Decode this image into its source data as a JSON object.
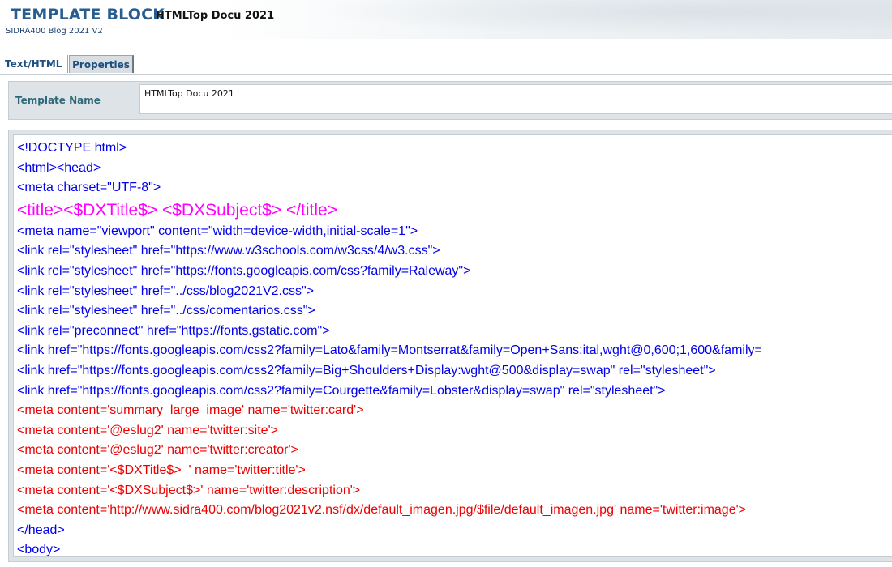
{
  "header": {
    "title": "TEMPLATE BLOCK",
    "subtitle": "HTMLTop Docu 2021",
    "app_name": "SIDRA400 Blog 2021 V2"
  },
  "tabs": [
    {
      "label": "Text/HTML",
      "active": true
    },
    {
      "label": "Properties",
      "active": false
    }
  ],
  "template_name": {
    "label": "Template Name",
    "value": "HTMLTop Docu 2021"
  },
  "colors": {
    "code_blue": "#0000ee",
    "code_magenta": "#ff00ff",
    "code_red": "#ee0000"
  },
  "code_lines": [
    {
      "text": "<!DOCTYPE html>",
      "color": "#0000ee"
    },
    {
      "text": "<html><head>",
      "color": "#0000ee"
    },
    {
      "text": "<meta charset=\"UTF-8\">",
      "color": "#0000ee"
    },
    {
      "text": "<title><$DXTitle$> <$DXSubject$> </title>",
      "color": "#ff00ff",
      "big": true
    },
    {
      "text": "<meta name=\"viewport\" content=\"width=device-width,initial-scale=1\">",
      "color": "#0000ee"
    },
    {
      "text": "<link rel=\"stylesheet\" href=\"https://www.w3schools.com/w3css/4/w3.css\">",
      "color": "#0000ee"
    },
    {
      "text": "<link rel=\"stylesheet\" href=\"https://fonts.googleapis.com/css?family=Raleway\">",
      "color": "#0000ee"
    },
    {
      "text": "<link rel=\"stylesheet\" href=\"../css/blog2021V2.css\">",
      "color": "#0000ee"
    },
    {
      "text": "<link rel=\"stylesheet\" href=\"../css/comentarios.css\">",
      "color": "#0000ee"
    },
    {
      "text": "<link rel=\"preconnect\" href=\"https://fonts.gstatic.com\">",
      "color": "#0000ee"
    },
    {
      "text": "<link href=\"https://fonts.googleapis.com/css2?family=Lato&family=Montserrat&family=Open+Sans:ital,wght@0,600;1,600&family=",
      "color": "#0000ee"
    },
    {
      "text": "<link href=\"https://fonts.googleapis.com/css2?family=Big+Shoulders+Display:wght@500&display=swap\" rel=\"stylesheet\">",
      "color": "#0000ee"
    },
    {
      "text": "<link href=\"https://fonts.googleapis.com/css2?family=Courgette&family=Lobster&display=swap\" rel=\"stylesheet\">",
      "color": "#0000ee"
    },
    {
      "text": "<meta content='summary_large_image' name='twitter:card'>",
      "color": "#ee0000"
    },
    {
      "text": "<meta content='@eslug2' name='twitter:site'>",
      "color": "#ee0000"
    },
    {
      "text": "<meta content='@eslug2' name='twitter:creator'>",
      "color": "#ee0000"
    },
    {
      "text": "<meta content='<$DXTitle$>  ' name='twitter:title'>",
      "color": "#ee0000"
    },
    {
      "text": "<meta content='<$DXSubject$>' name='twitter:description'>",
      "color": "#ee0000"
    },
    {
      "text": "<meta content='http://www.sidra400.com/blog2021v2.nsf/dx/default_imagen.jpg/$file/default_imagen.jpg' name='twitter:image'>",
      "color": "#ee0000"
    },
    {
      "text": "</head>",
      "color": "#0000ee"
    },
    {
      "text": "<body>",
      "color": "#0000ee"
    }
  ]
}
